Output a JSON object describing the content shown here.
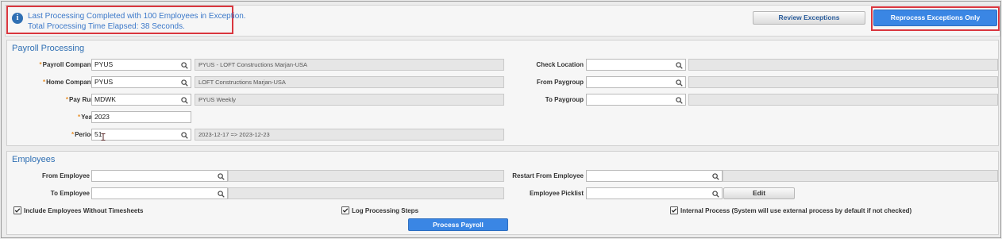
{
  "banner": {
    "line1": "Last Processing Completed with 100 Employees in Exception.",
    "line2": "Total Processing Time Elapsed: 38 Seconds.",
    "icon": "info-icon"
  },
  "toolbar": {
    "review_label": "Review Exceptions",
    "reprocess_label": "Reprocess Exceptions Only"
  },
  "payroll": {
    "title": "Payroll Processing",
    "payroll_company": {
      "label": "Payroll Company",
      "value": "PYUS",
      "desc": "PYUS - LOFT Constructions Marjan-USA"
    },
    "home_company": {
      "label": "Home Company",
      "value": "PYUS",
      "desc": "LOFT Constructions Marjan-USA"
    },
    "pay_run": {
      "label": "Pay Run",
      "value": "MDWK",
      "desc": "PYUS Weekly"
    },
    "year": {
      "label": "Year",
      "value": "2023"
    },
    "period": {
      "label": "Period",
      "value": "51",
      "desc": "2023-12-17  =>  2023-12-23"
    },
    "check_location": {
      "label": "Check Location",
      "value": "",
      "desc": ""
    },
    "from_paygroup": {
      "label": "From Paygroup",
      "value": "",
      "desc": ""
    },
    "to_paygroup": {
      "label": "To Paygroup",
      "value": "",
      "desc": ""
    }
  },
  "employees": {
    "title": "Employees",
    "from_employee": {
      "label": "From Employee",
      "value": "",
      "desc": ""
    },
    "to_employee": {
      "label": "To Employee",
      "value": "",
      "desc": ""
    },
    "restart_from": {
      "label": "Restart From Employee",
      "value": "",
      "desc": ""
    },
    "picklist": {
      "label": "Employee Picklist",
      "value": "",
      "edit_label": "Edit"
    },
    "include_without_timesheets": {
      "label": "Include Employees Without Timesheets",
      "checked": true
    },
    "log_steps": {
      "label": "Log Processing Steps",
      "checked": true
    },
    "internal_process": {
      "label": "Internal Process (System will use external process by default if not checked)",
      "checked": true
    },
    "process_button": "Process Payroll"
  },
  "colors": {
    "accent": "#3a86e4",
    "title": "#2f6fb3",
    "highlight": "#d9363e",
    "required": "#e8912c"
  }
}
